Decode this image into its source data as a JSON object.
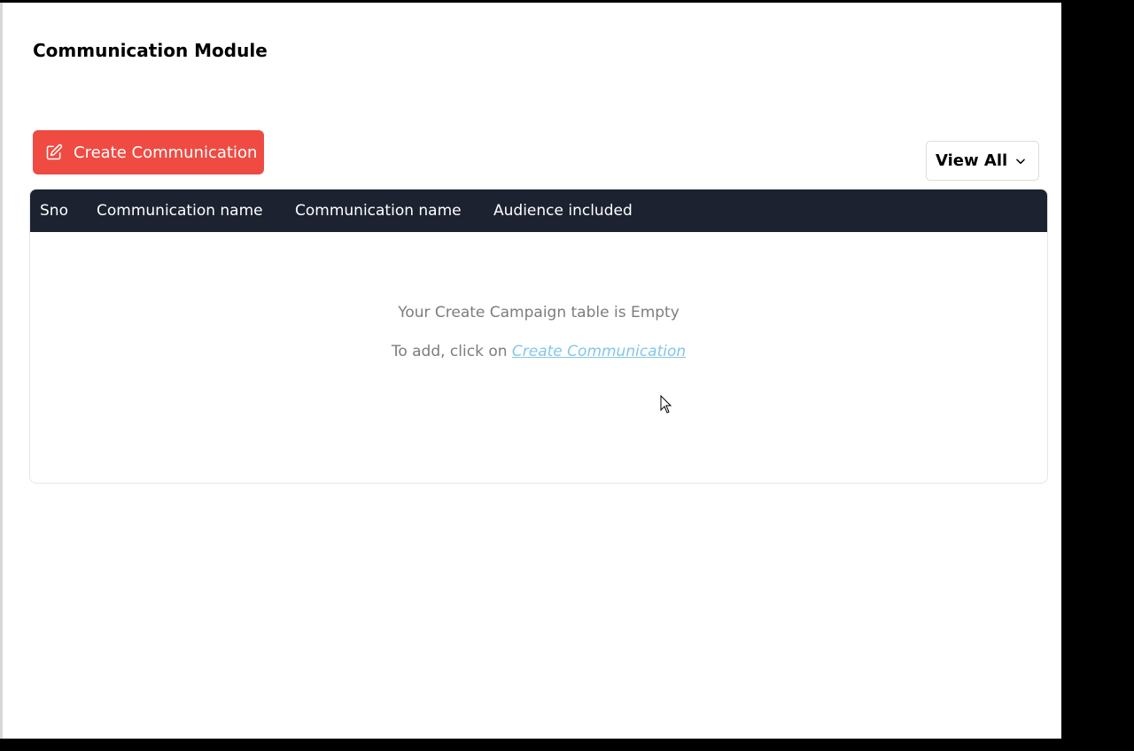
{
  "header": {
    "title": "Communication Module"
  },
  "toolbar": {
    "create_label": "Create Communication",
    "create_icon": "edit-icon",
    "filter_label": "View All",
    "filter_icon": "chevron-down-icon"
  },
  "table": {
    "columns": [
      "Sno",
      "Communication name",
      "Communication name",
      "Audience included"
    ],
    "rows": [],
    "empty_message": "Your Create Campaign table is Empty",
    "empty_hint_prefix": "To add, click on",
    "empty_hint_link": "Create Communication"
  },
  "colors": {
    "primary_button": "#ef4b43",
    "table_header": "#1c2230",
    "link": "#85c6e6",
    "muted_text": "#7d7d7d"
  }
}
